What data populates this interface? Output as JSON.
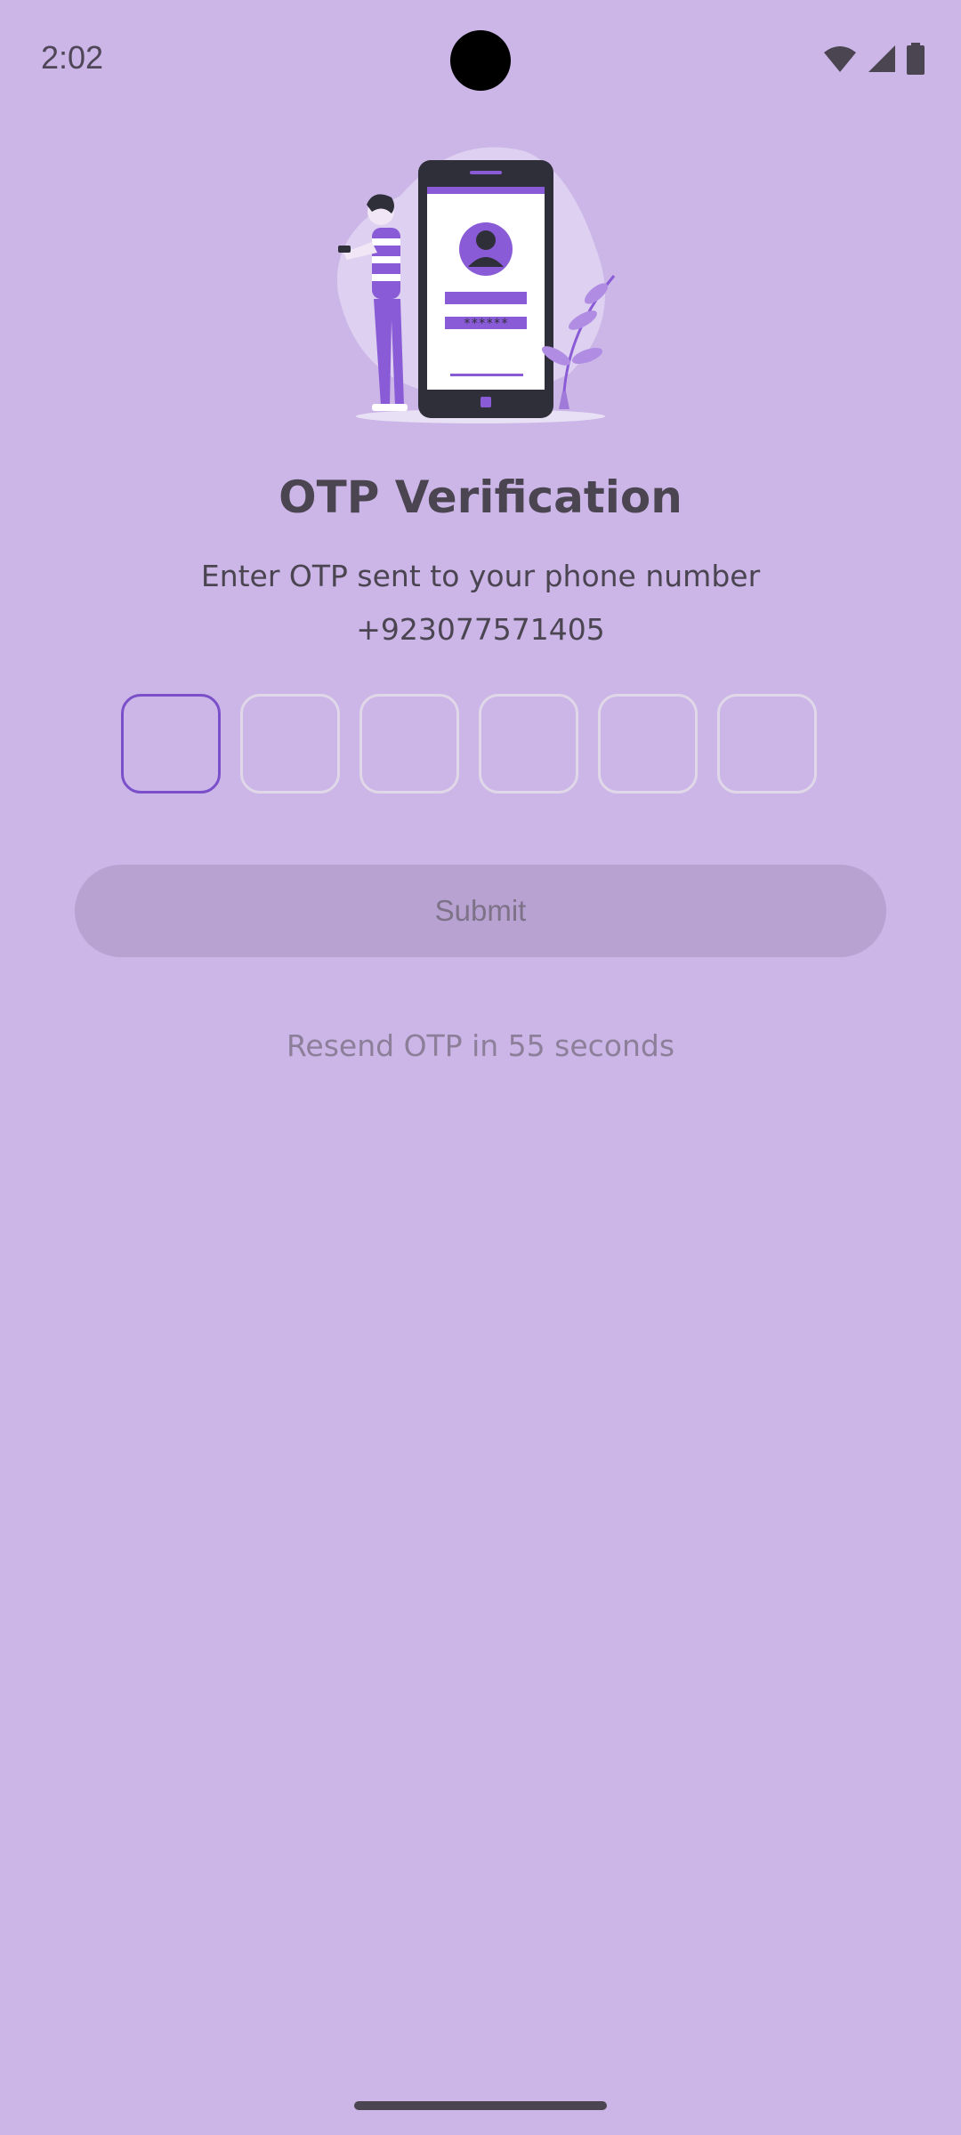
{
  "status_bar": {
    "time": "2:02",
    "icons": [
      "wifi-icon",
      "signal-icon",
      "battery-icon"
    ]
  },
  "illustration": {
    "name": "person-with-phone-illustration",
    "password_mask": "******"
  },
  "main": {
    "title": "OTP Verification",
    "subtitle": "Enter OTP sent to your phone number",
    "phone_number": "+923077571405",
    "otp_digits": [
      "",
      "",
      "",
      "",
      "",
      ""
    ],
    "submit_label": "Submit",
    "resend_text": "Resend OTP in 55 seconds"
  },
  "colors": {
    "background": "#cbb6e7",
    "accent": "#7a4fc9",
    "submit_bg": "#b7a2d2"
  }
}
